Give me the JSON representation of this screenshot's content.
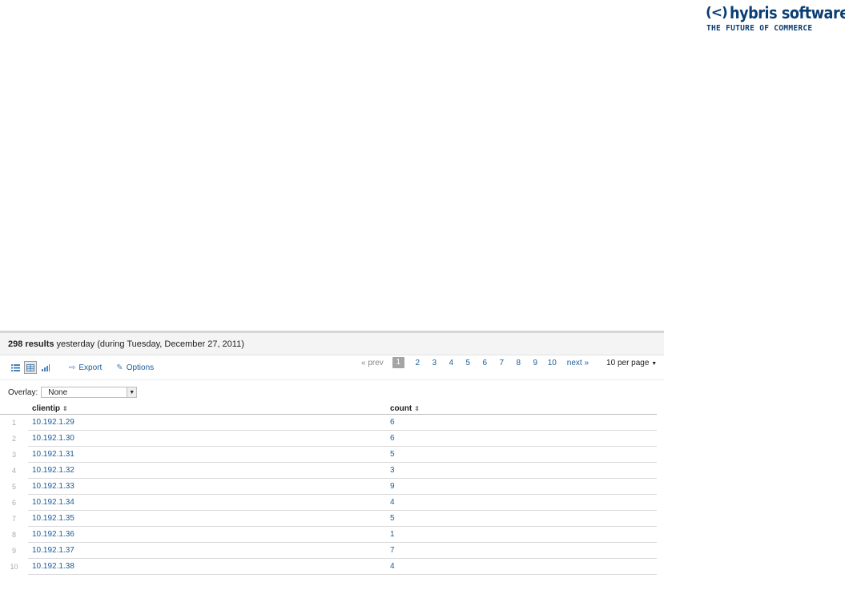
{
  "logo": {
    "mark": "(<)",
    "wordmark": "hybris software",
    "tagline": "THE FUTURE OF COMMERCE"
  },
  "results_header": {
    "count": "298 results",
    "timerange": "yesterday (during Tuesday, December 27, 2011)"
  },
  "toolbar": {
    "view_list_icon": "list-icon",
    "view_table_icon": "table-icon",
    "view_chart_icon": "bar-chart-icon",
    "export_label": "Export",
    "options_label": "Options"
  },
  "pager": {
    "prev": "« prev",
    "pages": [
      "1",
      "2",
      "3",
      "4",
      "5",
      "6",
      "7",
      "8",
      "9",
      "10"
    ],
    "current": "1",
    "next": "next »",
    "per_page": "10 per page"
  },
  "overlay": {
    "label": "Overlay:",
    "value": "None"
  },
  "table": {
    "columns": [
      "clientip",
      "count"
    ],
    "rows": [
      {
        "idx": "1",
        "clientip": "10.192.1.29",
        "count": "6"
      },
      {
        "idx": "2",
        "clientip": "10.192.1.30",
        "count": "6"
      },
      {
        "idx": "3",
        "clientip": "10.192.1.31",
        "count": "5"
      },
      {
        "idx": "4",
        "clientip": "10.192.1.32",
        "count": "3"
      },
      {
        "idx": "5",
        "clientip": "10.192.1.33",
        "count": "9"
      },
      {
        "idx": "6",
        "clientip": "10.192.1.34",
        "count": "4"
      },
      {
        "idx": "7",
        "clientip": "10.192.1.35",
        "count": "5"
      },
      {
        "idx": "8",
        "clientip": "10.192.1.36",
        "count": "1"
      },
      {
        "idx": "9",
        "clientip": "10.192.1.37",
        "count": "7"
      },
      {
        "idx": "10",
        "clientip": "10.192.1.38",
        "count": "4"
      }
    ]
  },
  "colors": {
    "link": "#1b5e99",
    "brand": "#0a3e73",
    "pager_current_bg": "#a4a4a4"
  }
}
